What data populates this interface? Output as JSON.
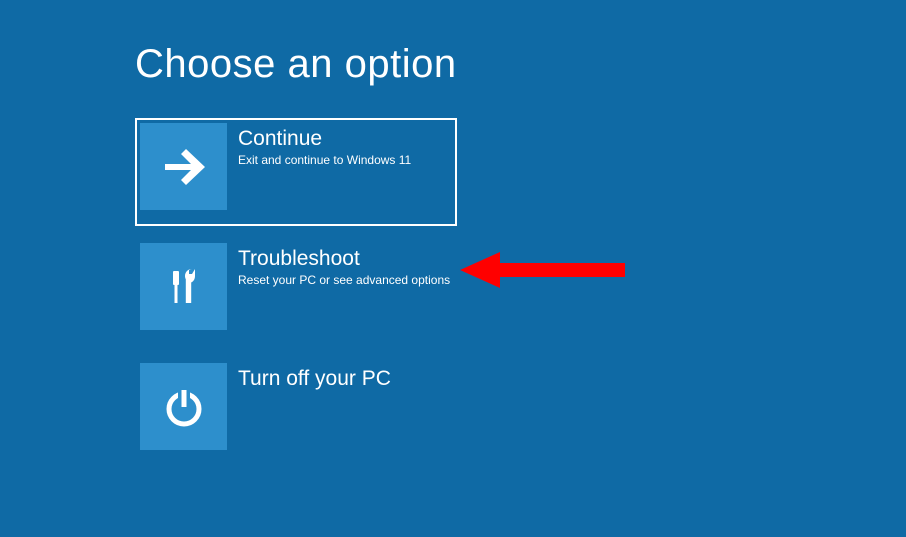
{
  "header": {
    "title": "Choose an option"
  },
  "options": {
    "continue": {
      "title": "Continue",
      "description": "Exit and continue to Windows 11"
    },
    "troubleshoot": {
      "title": "Troubleshoot",
      "description": "Reset your PC or see advanced options"
    },
    "turnoff": {
      "title": "Turn off your PC"
    }
  }
}
